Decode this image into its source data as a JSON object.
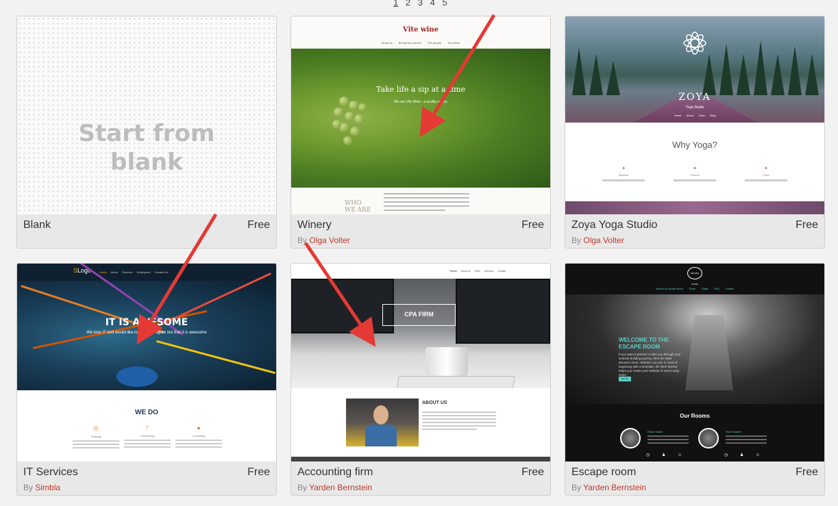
{
  "pagination": [
    "1",
    "2",
    "3",
    "4",
    "5"
  ],
  "colors": {
    "accent_link": "#c0392b",
    "arrow": "#e53935",
    "escape_teal": "#5ad1c8"
  },
  "templates": [
    {
      "name": "Blank",
      "price": "Free",
      "author_prefix": "",
      "author": "",
      "preview": {
        "headline": "Start from blank"
      }
    },
    {
      "name": "Winery",
      "price": "Free",
      "author_prefix": "By",
      "author": "Olga Volter",
      "preview": {
        "logo": "Vite wine",
        "nav": [
          "About us",
          "Behind the scenes",
          "The people",
          "The wines"
        ],
        "title": "Take life a sip at a time",
        "subtitle": "We are Vite Wine - a quality winery",
        "who": [
          "WHO",
          "WE ARE"
        ]
      }
    },
    {
      "name": "Zoya Yoga Studio",
      "price": "Free",
      "author_prefix": "By",
      "author": "Olga Volter",
      "preview": {
        "logo": "ZOYA",
        "studio": "Yoga Studio",
        "nav": [
          "Home",
          "About",
          "Class",
          "Blog"
        ],
        "heading": "Why Yoga?",
        "columns": [
          "Balance",
          "Fitness",
          "Food"
        ]
      }
    },
    {
      "name": "IT Services",
      "price": "Free",
      "author_prefix": "By",
      "author": "Simbla",
      "preview": {
        "logo": "Logo",
        "nav": [
          "Home",
          "About",
          "Services",
          "Employees",
          "Contact Us"
        ],
        "title": "IT IS AWESOME",
        "subtitle": "We love IT and would like to help you figure out that it is awesome",
        "heading": "WE DO",
        "columns": [
          "Training",
          "Connecting",
          "Consulting"
        ]
      }
    },
    {
      "name": "Accounting firm",
      "price": "Free",
      "author_prefix": "By",
      "author": "Yarden Bernstein",
      "preview": {
        "nav": [
          "Home",
          "About us",
          "Team",
          "Services",
          "Contact"
        ],
        "box": "CPA FIRM",
        "heading": "ABOUT US"
      }
    },
    {
      "name": "Escape room",
      "price": "Free",
      "author_prefix": "By",
      "author": "Yarden Bernstein",
      "preview": {
        "logo": "ESCAPE ROOM",
        "nav": [
          "What is an Escape Room",
          "Room",
          "Rates",
          "FAQ",
          "Contact"
        ],
        "welcome": [
          "WELCOME TO THE",
          "ESCAPE ROOM"
        ],
        "text": "If you want a partner to take you through your website-building journey, then the Web Wizard is here. Whether you are in need of beginning with a template, the Web Wizard helps you create your website in seven easy steps.",
        "button": "Start Now",
        "rooms_heading": "Our Rooms",
        "room_label": "Room Name"
      }
    }
  ]
}
